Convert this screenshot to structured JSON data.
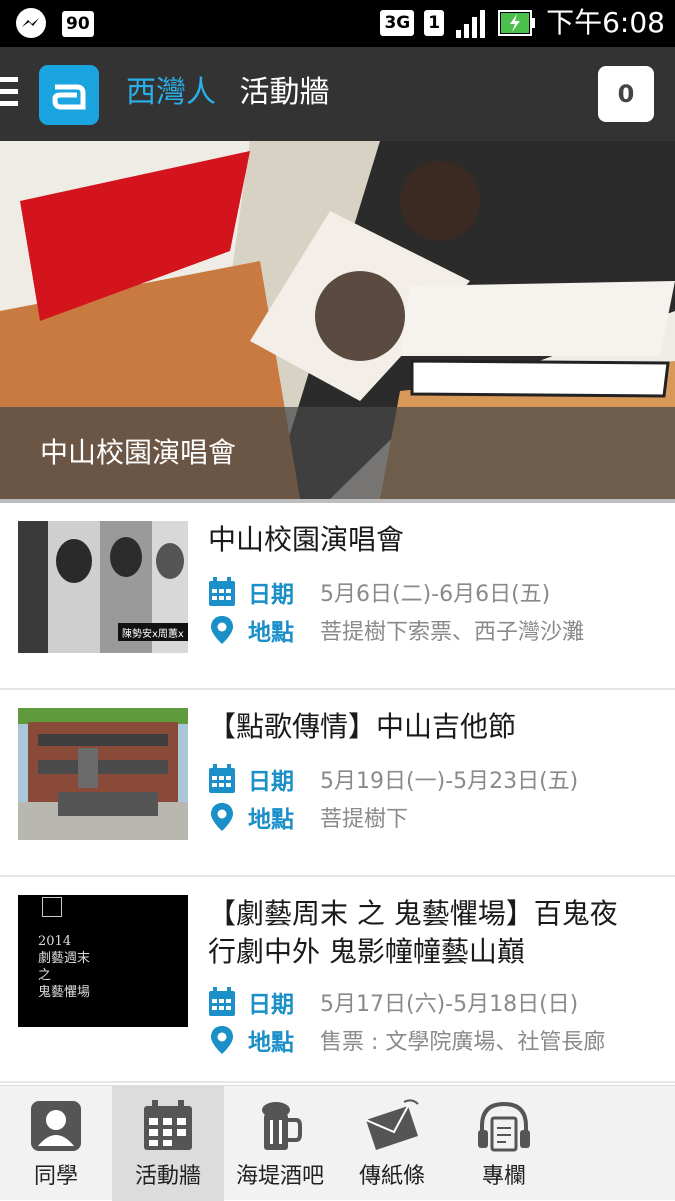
{
  "status_bar": {
    "badge_count": "90",
    "network": "3G",
    "sim": "1",
    "time": "下午6:08"
  },
  "app_bar": {
    "brand": "西灣人",
    "section": "活動牆",
    "notification_count": "0"
  },
  "hero": {
    "caption": "中山校園演唱會"
  },
  "events": [
    {
      "title": "中山校園演唱會",
      "date_label": "日期",
      "date_value": "5月6日(二)-6月6日(五)",
      "place_label": "地點",
      "place_value": "菩提樹下索票、西子灣沙灘",
      "thumb_caption": "陳勢安x周蕙x"
    },
    {
      "title": "【點歌傳情】中山吉他節",
      "date_label": "日期",
      "date_value": "5月19日(一)-5月23日(五)",
      "place_label": "地點",
      "place_value": "菩提樹下"
    },
    {
      "title": "【劇藝周末 之 鬼藝懼場】百鬼夜行劇中外 鬼影幢幢藝山巔",
      "date_label": "日期",
      "date_value": "5月17日(六)-5月18日(日)",
      "place_label": "地點",
      "place_value": "售票 : 文學院廣場、社管長廊",
      "thumb_lines": [
        "2014",
        "劇藝週末",
        "之",
        "鬼藝懼場"
      ]
    }
  ],
  "bottom_nav": [
    {
      "label": "同學",
      "icon": "person-icon"
    },
    {
      "label": "活動牆",
      "icon": "calendar-icon",
      "active": true
    },
    {
      "label": "海堤酒吧",
      "icon": "beer-mug-icon"
    },
    {
      "label": "傳紙條",
      "icon": "envelope-icon"
    },
    {
      "label": "專欄",
      "icon": "headphones-note-icon"
    }
  ],
  "colors": {
    "accent": "#1a8fc8",
    "app_bar": "#333333",
    "brand_blue": "#29b0e8"
  }
}
